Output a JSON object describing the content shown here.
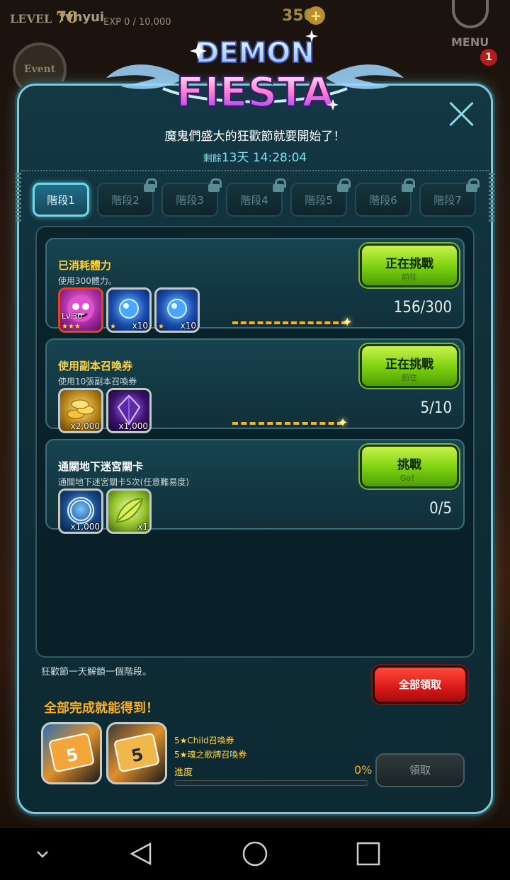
{
  "hud": {
    "level_prefix": "LEVEL",
    "level": "70",
    "player_name": "fvhyui",
    "exp": "EXP 0 / 10,000",
    "gold": "350",
    "menu_label": "MENU",
    "mail_badge": "1",
    "event_label": "Event"
  },
  "event": {
    "logo_line1": "DEMON",
    "logo_line2": "FIESTA",
    "subtitle": "魔鬼們盛大的狂歡節就要開始了！",
    "timer_label": "剩餘",
    "timer_value": "13天 14:28:04"
  },
  "tabs": [
    {
      "label": "階段1",
      "active": true,
      "locked": false
    },
    {
      "label": "階段2",
      "active": false,
      "locked": true
    },
    {
      "label": "階段3",
      "active": false,
      "locked": true
    },
    {
      "label": "階段4",
      "active": false,
      "locked": true
    },
    {
      "label": "階段5",
      "active": false,
      "locked": true
    },
    {
      "label": "階段6",
      "active": false,
      "locked": true
    },
    {
      "label": "階段7",
      "active": false,
      "locked": true
    }
  ],
  "tasks": [
    {
      "title": "已消耗體力",
      "description": "使用300體力。",
      "progress": "156/300",
      "progress_fraction": 0.52,
      "button_main": "正在挑戰",
      "button_sub": "前往",
      "rewards": [
        {
          "name": "purple-demon-card",
          "qty": "",
          "level": "Lv.30",
          "stars": "★★★"
        },
        {
          "name": "blue-gem",
          "qty": "x10",
          "level": "",
          "stars": "★"
        },
        {
          "name": "blue-gem",
          "qty": "x10",
          "level": "",
          "stars": "★"
        }
      ]
    },
    {
      "title": "使用副本召喚券",
      "description": "使用10張副本召喚券",
      "progress": "5/10",
      "progress_fraction": 0.5,
      "button_main": "正在挑戰",
      "button_sub": "前往",
      "rewards": [
        {
          "name": "gold-coins",
          "qty": "x2,000",
          "level": "",
          "stars": ""
        },
        {
          "name": "dark-crystal",
          "qty": "x1,000",
          "level": "",
          "stars": ""
        }
      ]
    },
    {
      "title": "通關地下迷宮關卡",
      "description": "通關地下迷宮關卡5次(任意難易度)",
      "progress": "0/5",
      "progress_fraction": 0,
      "button_main": "挑戰",
      "button_sub": "Go！",
      "rewards": [
        {
          "name": "silver-ring",
          "qty": "x1,000",
          "level": "",
          "stars": ""
        },
        {
          "name": "green-scroll",
          "qty": "x1",
          "level": "",
          "stars": ""
        }
      ]
    }
  ],
  "footer": {
    "note": "狂歡節一天解鎖一個階段。",
    "claim_all": "全部領取",
    "complete_label": "全部完成就能得到！",
    "final_rewards": [
      "5★Child召喚券",
      "5★魂之歌牌召喚券"
    ],
    "progress_label": "進度",
    "progress_pct": "0%",
    "progress_fraction": 0,
    "claim": "領取"
  },
  "colors": {
    "accent_cyan": "#7fe3ef",
    "gold": "#ffb21a",
    "go_green": "#7ad00e",
    "claim_red": "#d81818"
  }
}
